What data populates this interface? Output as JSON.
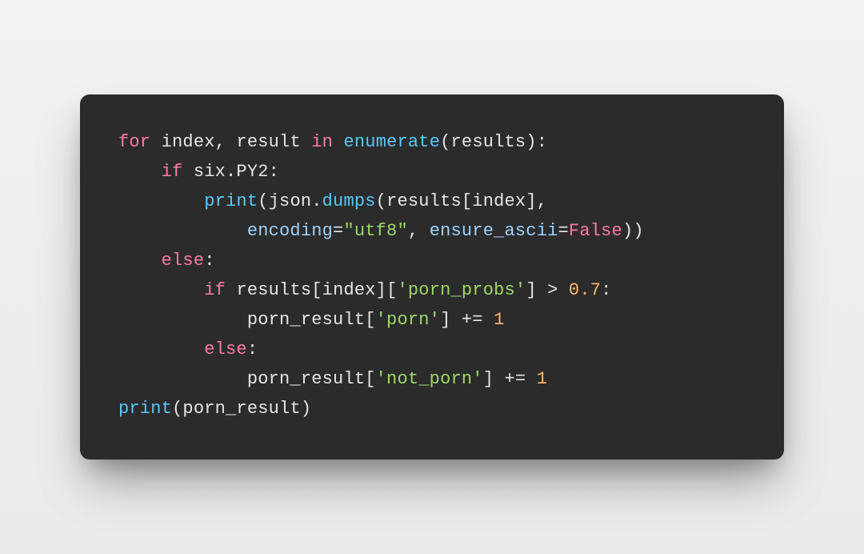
{
  "colors": {
    "background": "#efefef",
    "card": "#2b2b2b",
    "text": "#e6e6e6",
    "keyword": "#ff79a8",
    "function": "#58c9ff",
    "param": "#87c3ff",
    "string": "#9fd86a",
    "number": "#ffb870"
  },
  "code": {
    "raw": "for index, result in enumerate(results):\n    if six.PY2:\n        print(json.dumps(results[index],\n            encoding=\"utf8\", ensure_ascii=False))\n    else:\n        if results[index]['porn_probs'] > 0.7:\n            porn_result['porn'] += 1\n        else:\n            porn_result['not_porn'] += 1\nprint(porn_result)",
    "tokens": {
      "l1_for": "for",
      "l1_index": " index",
      "l1_comma": ",",
      "l1_result": " result ",
      "l1_in": "in",
      "l1_sp": " ",
      "l1_enum": "enumerate",
      "l1_open": "(",
      "l1_results": "results",
      "l1_close": "):",
      "l2_indent": "    ",
      "l2_if": "if",
      "l2_six": " six.PY2:",
      "l3_indent": "        ",
      "l3_print": "print",
      "l3_open": "(",
      "l3_json": "json.",
      "l3_dumps": "dumps",
      "l3_open2": "(",
      "l3_results": "results",
      "l3_idx": "[index],",
      "l4_indent": "            ",
      "l4_enc": "encoding",
      "l4_eq1": "=",
      "l4_utf8": "\"utf8\"",
      "l4_comma": ", ",
      "l4_ascii": "ensure_ascii",
      "l4_eq2": "=",
      "l4_false": "False",
      "l4_close": "))",
      "l5_indent": "    ",
      "l5_else": "else",
      "l5_colon": ":",
      "l6_indent": "        ",
      "l6_if": "if",
      "l6_sp": " ",
      "l6_results": "results",
      "l6_idx1": "[index][",
      "l6_str": "'porn_probs'",
      "l6_idx2": "] > ",
      "l6_num": "0.7",
      "l6_colon": ":",
      "l7_indent": "            ",
      "l7_porn": "porn_result[",
      "l7_str": "'porn'",
      "l7_close": "] += ",
      "l7_one": "1",
      "l8_indent": "        ",
      "l8_else": "else",
      "l8_colon": ":",
      "l9_indent": "            ",
      "l9_porn": "porn_result[",
      "l9_str": "'not_porn'",
      "l9_close": "] += ",
      "l9_one": "1",
      "l10_print": "print",
      "l10_open": "(",
      "l10_porn": "porn_result",
      "l10_close": ")"
    }
  }
}
